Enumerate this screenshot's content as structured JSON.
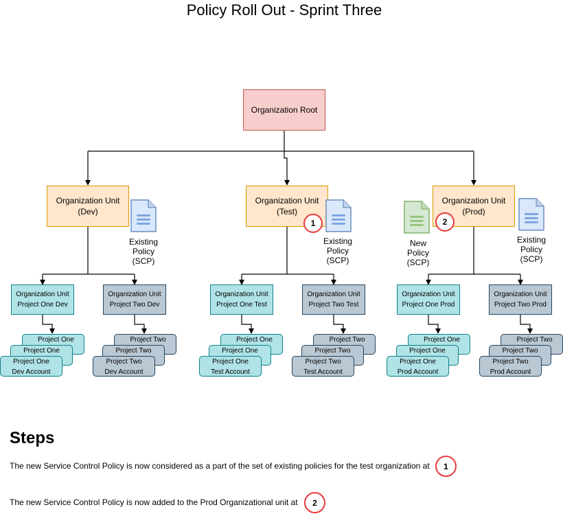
{
  "title": "Policy Roll Out - Sprint Three",
  "root": {
    "label": "Organization Root",
    "color": "#f8cecc"
  },
  "org_units": [
    {
      "id": "dev",
      "line1": "Organization Unit",
      "line2": "(Dev)"
    },
    {
      "id": "test",
      "line1": "Organization Unit",
      "line2": "(Test)"
    },
    {
      "id": "prod",
      "line1": "Organization Unit",
      "line2": "(Prod)"
    }
  ],
  "policies": {
    "existing": {
      "line1": "Existing",
      "line2": "Policy",
      "line3": "(SCP)",
      "color": "#dae8fc"
    },
    "new": {
      "line1": "New",
      "line2": "Policy",
      "line3": "(SCP)",
      "color": "#d5e8d4"
    }
  },
  "sub_units": [
    {
      "line1": "Organization Unit",
      "line2": "Project One Dev",
      "style": "teal"
    },
    {
      "line1": "Organization Unit",
      "line2": "Project Two Dev",
      "style": "gray"
    },
    {
      "line1": "Organization Unit",
      "line2": "Project One Test",
      "style": "teal"
    },
    {
      "line1": "Organization Unit",
      "line2": "Project Two Test",
      "style": "gray"
    },
    {
      "line1": "Organization Unit",
      "line2": "Project One Prod",
      "style": "teal"
    },
    {
      "line1": "Organization Unit",
      "line2": "Project Two Prod",
      "style": "gray"
    }
  ],
  "accounts": [
    {
      "back": "Project One",
      "mid": "Project One",
      "front1": "Project One",
      "front2": "Dev Account"
    },
    {
      "back": "Project Two",
      "mid": "Project Two",
      "front1": "Project Two",
      "front2": "Dev Account"
    },
    {
      "back": "Project One",
      "mid": "Project One",
      "front1": "Project One",
      "front2": "Test Account"
    },
    {
      "back": "Project Two",
      "mid": "Project Two",
      "front1": "Project Two",
      "front2": "Test Account"
    },
    {
      "back": "Project One",
      "mid": "Project One",
      "front1": "Project One",
      "front2": "Prod Account"
    },
    {
      "back": "Project Two",
      "mid": "Project Two",
      "front1": "Project Two",
      "front2": "Prod Account"
    }
  ],
  "badges": {
    "one": "1",
    "two": "2"
  },
  "steps": {
    "heading": "Steps",
    "items": [
      {
        "text": "The new Service Control Policy is now considered as a part of the set of existing policies for the test organization at",
        "badge": "1"
      },
      {
        "text": "The new Service Control Policy is now added to the Prod Organizational unit at",
        "badge": "2"
      }
    ]
  }
}
